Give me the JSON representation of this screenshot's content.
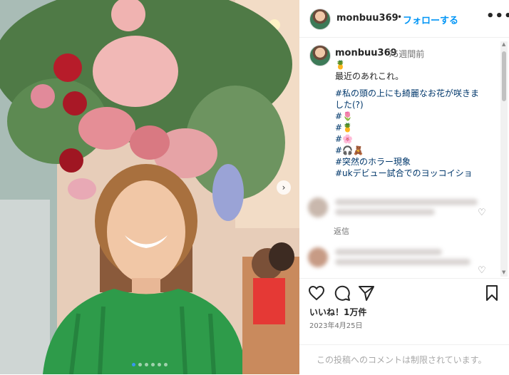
{
  "header": {
    "username": "monbuu369",
    "separator": "•",
    "follow_label": "フォローする",
    "more_label": "•••"
  },
  "caption": {
    "username": "monbuu369",
    "time": "75週間前",
    "lines": [
      "🍍",
      "最近のあれこれ。",
      "",
      "#私の頭の上にも綺麗なお花が咲きま",
      "した(?)",
      "#🌷",
      "#🍍",
      "#🌸",
      "#🎧🧸",
      "#突然のホラー現象",
      "#ukデビュー試合でのヨッコイショ"
    ]
  },
  "comments": {
    "reply_label": "返信",
    "heart_icon": "heart-outline-icon"
  },
  "actions": {
    "likes": "いいね！1万件",
    "date": "2023年4月25日"
  },
  "comments_restricted": "この投稿へのコメントは制限されています。",
  "carousel": {
    "next_label": "›",
    "dot_count": 6,
    "active_dot": 0
  },
  "colors": {
    "accent": "#0095f6",
    "hashtag": "#00376b"
  }
}
